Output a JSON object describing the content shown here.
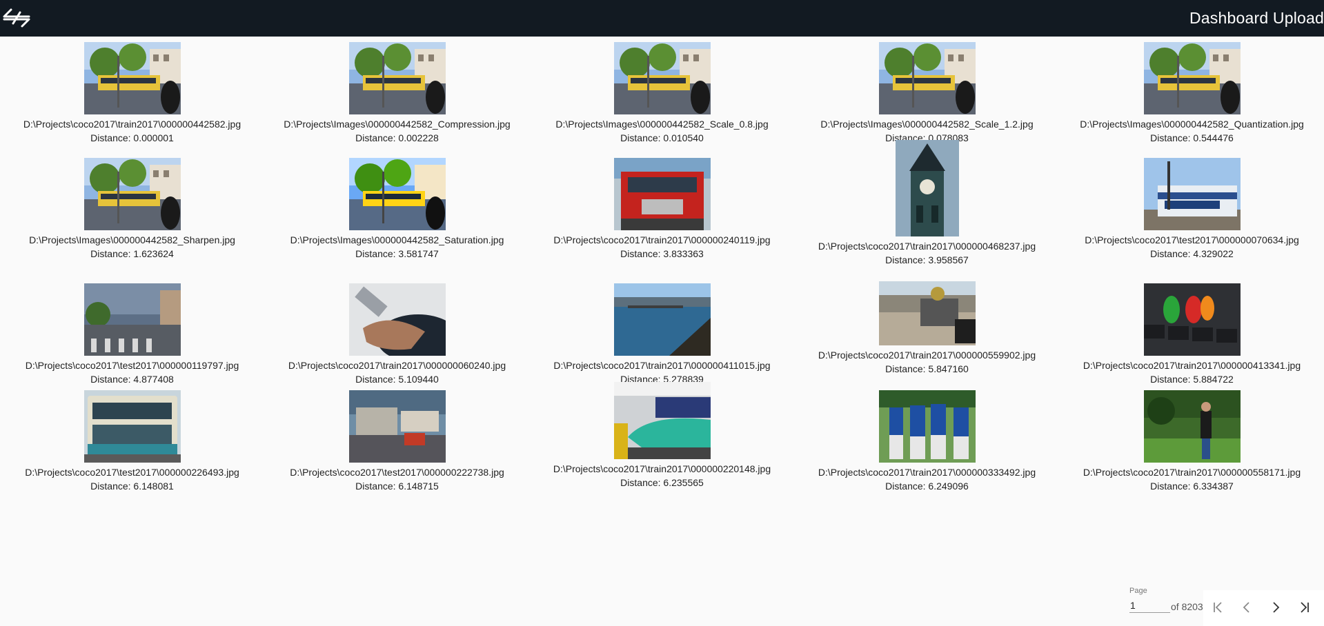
{
  "header": {
    "logo_icon": "swap-arrows-logo-icon",
    "title": "Dashboard Upload"
  },
  "results": [
    {
      "path": "D:\\Projects\\coco2017\\train2017\\000000442582.jpg",
      "distance": "Distance: 0.000001",
      "scene": "street-bus"
    },
    {
      "path": "D:\\Projects\\Images\\000000442582_Compression.jpg",
      "distance": "Distance: 0.002228",
      "scene": "street-bus"
    },
    {
      "path": "D:\\Projects\\Images\\000000442582_Scale_0.8.jpg",
      "distance": "Distance: 0.010540",
      "scene": "street-bus"
    },
    {
      "path": "D:\\Projects\\Images\\000000442582_Scale_1.2.jpg",
      "distance": "Distance: 0.078083",
      "scene": "street-bus"
    },
    {
      "path": "D:\\Projects\\Images\\000000442582_Quantization.jpg",
      "distance": "Distance: 0.544476",
      "scene": "street-bus"
    },
    {
      "path": "D:\\Projects\\Images\\000000442582_Sharpen.jpg",
      "distance": "Distance: 1.623624",
      "scene": "street-bus"
    },
    {
      "path": "D:\\Projects\\Images\\000000442582_Saturation.jpg",
      "distance": "Distance: 3.581747",
      "scene": "street-bus-saturated"
    },
    {
      "path": "D:\\Projects\\coco2017\\train2017\\000000240119.jpg",
      "distance": "Distance: 3.833363",
      "scene": "fire-truck"
    },
    {
      "path": "D:\\Projects\\coco2017\\train2017\\000000468237.jpg",
      "distance": "Distance: 3.958567",
      "scene": "clock-tower"
    },
    {
      "path": "D:\\Projects\\coco2017\\test2017\\000000070634.jpg",
      "distance": "Distance: 4.329022",
      "scene": "train"
    },
    {
      "path": "D:\\Projects\\coco2017\\test2017\\000000119797.jpg",
      "distance": "Distance: 4.877408",
      "scene": "crosswalk"
    },
    {
      "path": "D:\\Projects\\coco2017\\train2017\\000000060240.jpg",
      "distance": "Distance: 5.109440",
      "scene": "hand-phone"
    },
    {
      "path": "D:\\Projects\\coco2017\\train2017\\000000411015.jpg",
      "distance": "Distance: 5.278839",
      "scene": "pier"
    },
    {
      "path": "D:\\Projects\\coco2017\\train2017\\000000559902.jpg",
      "distance": "Distance: 5.847160",
      "scene": "desert-cart"
    },
    {
      "path": "D:\\Projects\\coco2017\\train2017\\000000413341.jpg",
      "distance": "Distance: 5.884722",
      "scene": "gummy-bears"
    },
    {
      "path": "D:\\Projects\\coco2017\\test2017\\000000226493.jpg",
      "distance": "Distance: 6.148081",
      "scene": "double-decker"
    },
    {
      "path": "D:\\Projects\\coco2017\\test2017\\000000222738.jpg",
      "distance": "Distance: 6.148715",
      "scene": "market"
    },
    {
      "path": "D:\\Projects\\coco2017\\train2017\\000000220148.jpg",
      "distance": "Distance: 6.235565",
      "scene": "bullet-train"
    },
    {
      "path": "D:\\Projects\\coco2017\\train2017\\000000333492.jpg",
      "distance": "Distance: 6.249096",
      "scene": "baseball"
    },
    {
      "path": "D:\\Projects\\coco2017\\train2017\\000000558171.jpg",
      "distance": "Distance: 6.334387",
      "scene": "park-man"
    }
  ],
  "pagination": {
    "page_label": "Page",
    "current_page": "1",
    "of_total": "of 8203",
    "first_icon": "first-page-icon",
    "prev_icon": "chevron-left-icon",
    "next_icon": "chevron-right-icon",
    "last_icon": "last-page-icon"
  },
  "colors": {
    "topbar": "#121a22",
    "background": "#fafafa"
  }
}
